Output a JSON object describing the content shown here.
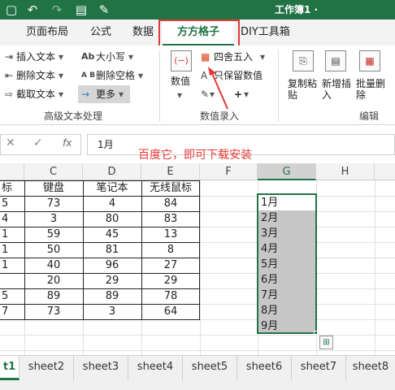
{
  "titlebar": {
    "title": "工作簿1 ·",
    "save_icon": "save-icon",
    "undo_icon": "undo-icon",
    "redo_icon": "redo-icon",
    "file_icon": "file-icon",
    "brush_icon": "format-painter-icon"
  },
  "tabs": [
    {
      "label": "页面布局"
    },
    {
      "label": "公式"
    },
    {
      "label": "数据"
    },
    {
      "label": "方方格子"
    },
    {
      "label": "DIY工具箱"
    }
  ],
  "ribbon": {
    "text_group": {
      "insert": "插入文本",
      "delete": "删除文本",
      "extract": "截取文本",
      "case": "大小写",
      "delete_space": "删除空格",
      "more": "更多",
      "dropdown": "▾",
      "label": "高级文本处理"
    },
    "number_group": {
      "value": "数值",
      "four_five": "四舍五入",
      "keep_value": "只保留数值",
      "plus": "+",
      "label": "数值录入"
    },
    "edit_group": {
      "copy_paste": "复制粘贴",
      "add_insert": "新增插入",
      "batch_delete": "批量删除",
      "label": "编辑"
    }
  },
  "formula_bar": {
    "cancel": "✕",
    "confirm": "✓",
    "fx": "fx",
    "value": "1月"
  },
  "annotation": {
    "text": "百度它，即可下载安装"
  },
  "columns": [
    "C",
    "D",
    "E",
    "F",
    "G",
    "H"
  ],
  "table": {
    "header": [
      "标",
      "键盘",
      "笔记本",
      "无线鼠标"
    ],
    "rows": [
      [
        "5",
        "73",
        "4",
        "84"
      ],
      [
        "4",
        "3",
        "80",
        "83"
      ],
      [
        "1",
        "59",
        "45",
        "13"
      ],
      [
        "1",
        "50",
        "81",
        "8"
      ],
      [
        "1",
        "40",
        "96",
        "27"
      ],
      [
        "",
        "20",
        "29",
        "29"
      ],
      [
        "5",
        "89",
        "89",
        "78"
      ],
      [
        "7",
        "73",
        "3",
        "64"
      ]
    ]
  },
  "g_column": [
    "1月",
    "2月",
    "3月",
    "4月",
    "5月",
    "6月",
    "7月",
    "8月",
    "9月"
  ],
  "sheets": [
    {
      "label": "t1"
    },
    {
      "label": "sheet2"
    },
    {
      "label": "sheet3"
    },
    {
      "label": "sheet4"
    },
    {
      "label": "sheet5"
    },
    {
      "label": "sheet6"
    },
    {
      "label": "sheet7"
    },
    {
      "label": "sheet8"
    }
  ],
  "colors": {
    "excel_green": "#217346",
    "annotation_red": "#e53935",
    "selection_gray": "#c6c6c6"
  }
}
